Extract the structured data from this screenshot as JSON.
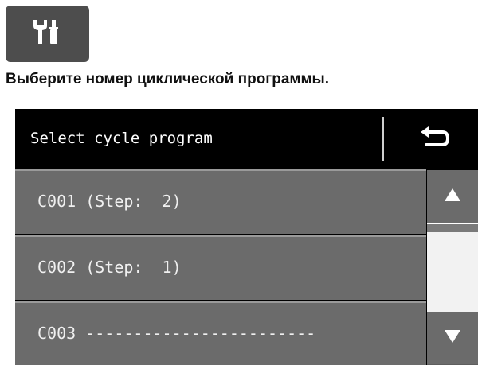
{
  "instruction_text": "Выберите номер циклической программы.",
  "tool_icon": "wrench-screwdriver-icon",
  "screen": {
    "title": "Select cycle program",
    "back_icon": "return-arrow-icon",
    "items": [
      {
        "label": "C001 (Step:  2)"
      },
      {
        "label": "C002 (Step:  1)"
      },
      {
        "label": "C003 ------------------------"
      }
    ],
    "scroll_up_icon": "triangle-up-icon",
    "scroll_down_icon": "triangle-down-icon"
  },
  "colors": {
    "header_bg": "#000000",
    "item_bg": "#6b6b6b",
    "item_text": "#f0f0f0",
    "scroll_track": "#f2f2f2"
  }
}
